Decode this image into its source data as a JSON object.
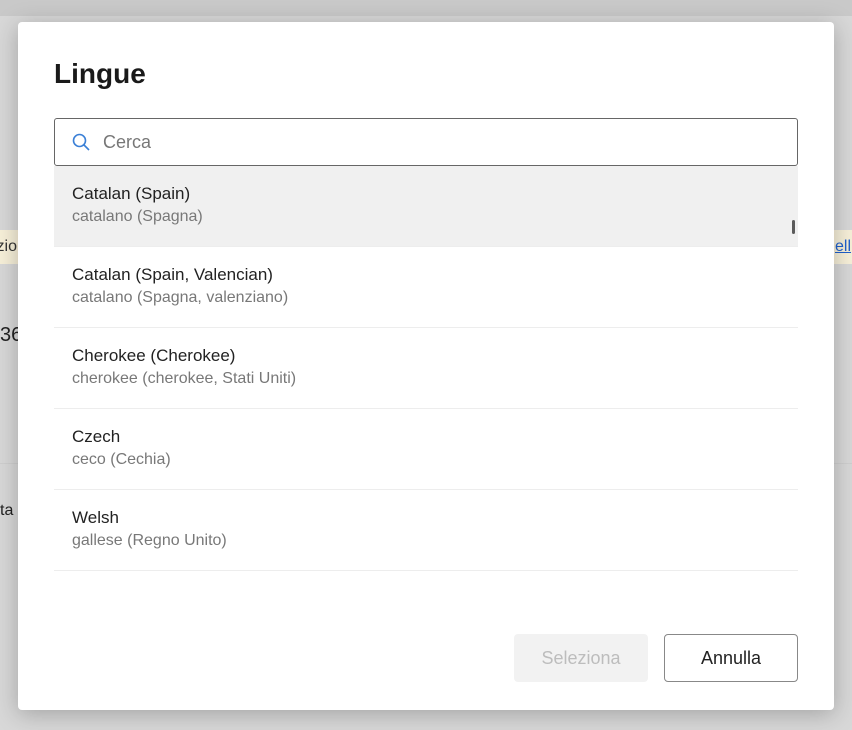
{
  "bg": {
    "left_top": "zio",
    "right_top": "ell",
    "num": "36",
    "ta": "ta"
  },
  "dialog": {
    "title": "Lingue",
    "search": {
      "placeholder": "Cerca",
      "value": ""
    },
    "items": [
      {
        "primary": "Catalan (Spain)",
        "secondary": "catalano (Spagna)",
        "selected": true
      },
      {
        "primary": "Catalan (Spain, Valencian)",
        "secondary": "catalano (Spagna, valenziano)",
        "selected": false
      },
      {
        "primary": "Cherokee (Cherokee)",
        "secondary": "cherokee (cherokee, Stati Uniti)",
        "selected": false
      },
      {
        "primary": "Czech",
        "secondary": "ceco (Cechia)",
        "selected": false
      },
      {
        "primary": "Welsh",
        "secondary": "gallese (Regno Unito)",
        "selected": false
      }
    ],
    "buttons": {
      "select": "Seleziona",
      "cancel": "Annulla"
    }
  }
}
